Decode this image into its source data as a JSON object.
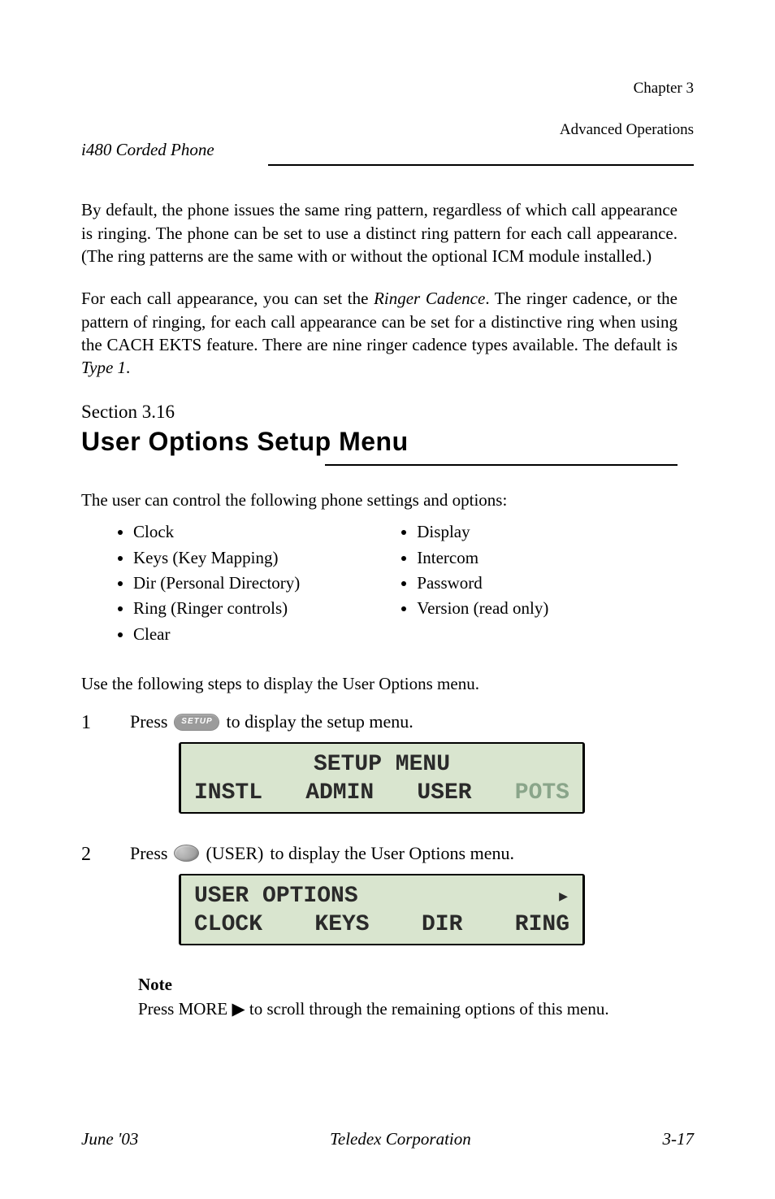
{
  "header": {
    "top_left": "i480 Corded Phone",
    "chapter_line1": "Chapter 3",
    "chapter_line2": "Advanced Operations"
  },
  "intro": {
    "p1": "By default, the phone issues the same ring pattern, regardless of which call appearance is ringing. The phone can be set to use a distinct ring pattern for each call appearance. (The ring patterns are the same with or without the optional ICM module installed.)",
    "p2_prefix": "For each call appearance, you can set the ",
    "p2_em": "Ringer Cadence",
    "p2_mid": ". The ringer cadence, or the pattern of ringing, for each call appearance can be set for a distinctive ring when using the CACH EKTS feature. There are nine ringer cadence types available. The default is ",
    "p2_em2": "Type 1",
    "p2_suffix": "."
  },
  "section": {
    "label": "Section 3.16",
    "title": "User Options Setup Menu"
  },
  "user_text": "The user can control the following phone settings and options:",
  "list_left": [
    "Clock",
    "Keys (Key Mapping)",
    "Dir (Personal Directory)",
    "Ring (Ringer controls)",
    "Clear"
  ],
  "list_right": [
    "Display",
    "Intercom",
    "Password",
    "Version (read only)"
  ],
  "steps_lead": "Use the following steps to display the User Options menu.",
  "step1": {
    "num": "1",
    "text_before": "Press",
    "text_after": "to display the setup menu.",
    "lcd": {
      "row1": "SETUP MENU",
      "row2": [
        "INSTL",
        "ADMIN",
        "USER",
        "POTS"
      ]
    }
  },
  "step2": {
    "num": "2",
    "text_before": "Press",
    "softkey_label": "(USER)",
    "text_after": "to display the User Options menu.",
    "lcd": {
      "row1": "USER OPTIONS",
      "row2": [
        "CLOCK",
        "KEYS",
        "DIR",
        "RING"
      ]
    }
  },
  "note": {
    "title": "Note",
    "body_prefix": "Press MORE",
    "body_suffix": "to scroll through the remaining options of this menu."
  },
  "footer": {
    "date": "June '03",
    "company": "Teledex Corporation",
    "page": "3-17"
  }
}
